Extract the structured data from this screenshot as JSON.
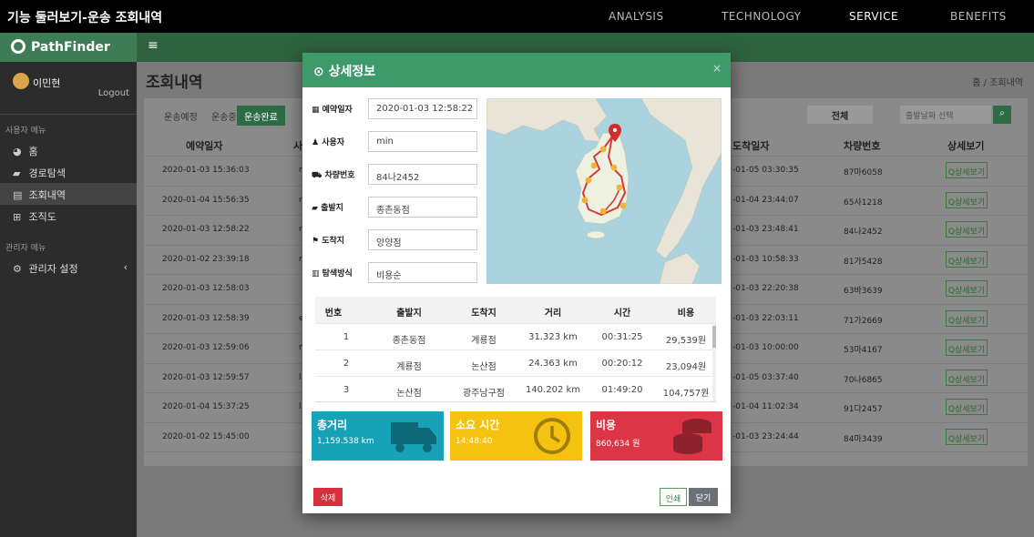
{
  "window": {
    "title": "기능 둘러보기-운송 조회내역"
  },
  "nav": [
    {
      "label": "ANALYSIS",
      "active": false
    },
    {
      "label": "TECHNOLOGY",
      "active": false
    },
    {
      "label": "SERVICE",
      "active": true
    },
    {
      "label": "BENEFITS",
      "active": false
    }
  ],
  "sidebar": {
    "brand": "PathFinder",
    "user_name": "이민현",
    "logout": "Logout",
    "section_user": "사용자 메뉴",
    "items": [
      {
        "icon": "dashboard-icon",
        "glyph": "◕",
        "label": "홈"
      },
      {
        "icon": "truck-icon",
        "glyph": "▰",
        "label": "경로탐색"
      },
      {
        "icon": "list-icon",
        "glyph": "▤",
        "label": "조회내역"
      },
      {
        "icon": "table-icon",
        "glyph": "⊞",
        "label": "조직도"
      }
    ],
    "section_admin": "관리자 메뉴",
    "admin_item": {
      "icon": "gears-icon",
      "glyph": "⚙",
      "label": "관리자 설정",
      "caret": "‹"
    }
  },
  "main": {
    "menu_glyph": "≡",
    "title": "조회내역",
    "breadcrumb": "홈 / 조회내역",
    "tabs": [
      "운송예정",
      "운송중",
      "운송완료"
    ],
    "filter_all": "전체",
    "search_placeholder": "출발날짜 선택",
    "columns": [
      "예약일자",
      "사",
      "도착일자",
      "차량번호",
      "상세보기"
    ],
    "rows": [
      {
        "date": "2020-01-03 15:36:03",
        "user": "r",
        "arrive": "-01-05 03:30:35",
        "car": "87마6058"
      },
      {
        "date": "2020-01-04 15:56:35",
        "user": "r",
        "arrive": "-01-04 23:44:07",
        "car": "65사1218"
      },
      {
        "date": "2020-01-03 12:58:22",
        "user": "r",
        "arrive": "-01-03 23:48:41",
        "car": "84나2452"
      },
      {
        "date": "2020-01-02 23:39:18",
        "user": "r",
        "arrive": "-01-03 10:58:33",
        "car": "81가5428"
      },
      {
        "date": "2020-01-03 12:58:03",
        "user": "",
        "arrive": "-01-03 22:20:38",
        "car": "63바3639"
      },
      {
        "date": "2020-01-03 12:58:39",
        "user": "eh",
        "arrive": "-01-03 22:03:11",
        "car": "71가2669"
      },
      {
        "date": "2020-01-03 12:59:06",
        "user": "m",
        "arrive": "-01-03 10:00:00",
        "car": "53마4167"
      },
      {
        "date": "2020-01-03 12:59:57",
        "user": "l",
        "arrive": "-01-05 03:37:40",
        "car": "70나6865"
      },
      {
        "date": "2020-01-04 15:37:25",
        "user": "l",
        "arrive": "-01-04 11:02:34",
        "car": "91다2457"
      },
      {
        "date": "2020-01-02 15:45:00",
        "user": "",
        "arrive": "-01-03 23:24:44",
        "car": "84마3439"
      }
    ],
    "detail_btn": "Q상세보기"
  },
  "modal": {
    "title": "상세정보",
    "title_glyph": "⊙",
    "close": "×",
    "fields": [
      {
        "label": "예약일자",
        "glyph": "▦",
        "value": "2020-01-03 12:58:22"
      },
      {
        "label": "사용자",
        "glyph": "♟",
        "value": "min"
      },
      {
        "label": "차량번호",
        "glyph": "⛟",
        "value": "84나2452"
      },
      {
        "label": "출발지",
        "glyph": "▰",
        "value": "종촌동점"
      },
      {
        "label": "도착지",
        "glyph": "⚑",
        "value": "양양점"
      },
      {
        "label": "탐색방식",
        "glyph": "▥",
        "value": "비용순"
      }
    ],
    "table": {
      "columns": [
        "번호",
        "출발지",
        "도착지",
        "거리",
        "시간",
        "비용"
      ],
      "rows": [
        [
          "1",
          "종촌동점",
          "계룡점",
          "31.323 km",
          "00:31:25",
          "29,539원"
        ],
        [
          "2",
          "계룡점",
          "논산점",
          "24.363 km",
          "00:20:12",
          "23,094원"
        ],
        [
          "3",
          "논산점",
          "광주남구점",
          "140.202 km",
          "01:49:20",
          "104,757원"
        ]
      ]
    },
    "stats": [
      {
        "label": "총거리",
        "value": "1,159.538 km",
        "color": "#17a2b8",
        "icon": "truck-icon"
      },
      {
        "label": "소요 시간",
        "value": "14:48:40",
        "color": "#f5c211",
        "icon": "clock-icon"
      },
      {
        "label": "비용",
        "value": "860,634 원",
        "color": "#dc3545",
        "icon": "coins-icon"
      }
    ],
    "buttons": {
      "delete": "삭제",
      "print": "인쇄",
      "close": "닫기"
    }
  }
}
